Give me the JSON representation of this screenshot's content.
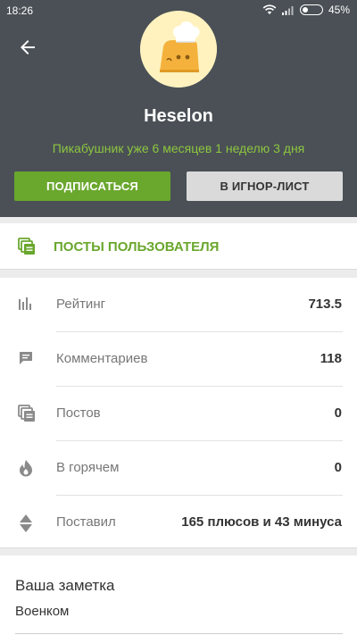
{
  "statusbar": {
    "time": "18:26",
    "battery": "45%",
    "icons": [
      "wifi-icon",
      "signal-icon",
      "battery-icon"
    ]
  },
  "header": {
    "back_icon": "arrow-left-icon",
    "username": "Heselon",
    "member_since": "Пикабушник уже 6 месяцев 1 неделю 3 дня",
    "subscribe_label": "Подписаться",
    "ignore_label": "В игнор-лист"
  },
  "posts": {
    "icon": "posts-stack-icon",
    "label": "Посты пользователя"
  },
  "stats": [
    {
      "icon": "bar-chart-icon",
      "label": "Рейтинг",
      "value": "713.5"
    },
    {
      "icon": "comment-icon",
      "label": "Комментариев",
      "value": "118"
    },
    {
      "icon": "posts-stack-icon",
      "label": "Постов",
      "value": "0"
    },
    {
      "icon": "flame-icon",
      "label": "В горячем",
      "value": "0"
    },
    {
      "icon": "up-down-arrows-icon",
      "label": "Поставил",
      "value": "165 плюсов и 43 минуса"
    }
  ],
  "note": {
    "title": "Ваша заметка",
    "text": "Военком"
  },
  "colors": {
    "header_bg": "#4a5056",
    "accent_green": "#6aa72d",
    "member_text_green": "#8dc63f",
    "ignore_button_bg": "#dadada",
    "page_bg": "#ececec"
  }
}
